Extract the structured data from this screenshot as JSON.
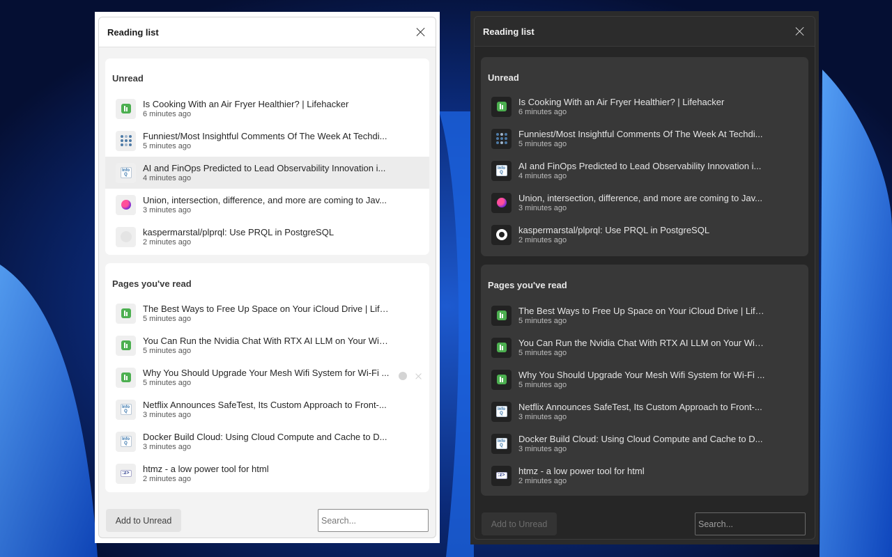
{
  "panels": {
    "light": {
      "title": "Reading list",
      "unread_heading": "Unread",
      "read_heading": "Pages you've read",
      "add_button_label": "Add to Unread",
      "search_placeholder": "Search...",
      "unread": [
        {
          "title": "Is Cooking With an Air Fryer Healthier? | Lifehacker",
          "time": "6 minutes ago",
          "icon": "lifehacker-icon"
        },
        {
          "title": "Funniest/Most Insightful Comments Of The Week At Techdi...",
          "time": "5 minutes ago",
          "icon": "techdirt-icon"
        },
        {
          "title": "AI and FinOps Predicted to Lead Observability Innovation i...",
          "time": "4 minutes ago",
          "icon": "infoq-icon"
        },
        {
          "title": "Union, intersection, difference, and more are coming to Jav...",
          "time": "3 minutes ago",
          "icon": "union-site-icon"
        },
        {
          "title": "kaspermarstal/plprql: Use PRQL in PostgreSQL",
          "time": "2 minutes ago",
          "icon": "github-icon"
        }
      ],
      "read": [
        {
          "title": "The Best Ways to Free Up Space on Your iCloud Drive | Life...",
          "time": "5 minutes ago",
          "icon": "lifehacker-icon"
        },
        {
          "title": "You Can Run the Nvidia Chat With RTX AI LLM on Your Win...",
          "time": "5 minutes ago",
          "icon": "lifehacker-icon"
        },
        {
          "title": "Why You Should Upgrade Your Mesh Wifi System for Wi-Fi ...",
          "time": "5 minutes ago",
          "icon": "lifehacker-icon"
        },
        {
          "title": "Netflix Announces SafeTest, Its Custom Approach to Front-...",
          "time": "3 minutes ago",
          "icon": "infoq-icon"
        },
        {
          "title": "Docker Build Cloud: Using Cloud Compute and Cache to D...",
          "time": "3 minutes ago",
          "icon": "infoq-icon"
        },
        {
          "title": "htmz - a low power tool for html",
          "time": "2 minutes ago",
          "icon": "htmz-icon"
        }
      ]
    },
    "dark": {
      "title": "Reading list",
      "unread_heading": "Unread",
      "read_heading": "Pages you've read",
      "add_button_label": "Add to Unread",
      "search_placeholder": "Search...",
      "unread": [
        {
          "title": "Is Cooking With an Air Fryer Healthier? | Lifehacker",
          "time": "6 minutes ago",
          "icon": "lifehacker-icon"
        },
        {
          "title": "Funniest/Most Insightful Comments Of The Week At Techdi...",
          "time": "5 minutes ago",
          "icon": "techdirt-icon"
        },
        {
          "title": "AI and FinOps Predicted to Lead Observability Innovation i...",
          "time": "4 minutes ago",
          "icon": "infoq-icon"
        },
        {
          "title": "Union, intersection, difference, and more are coming to Jav...",
          "time": "3 minutes ago",
          "icon": "union-site-icon"
        },
        {
          "title": "kaspermarstal/plprql: Use PRQL in PostgreSQL",
          "time": "2 minutes ago",
          "icon": "github-icon"
        }
      ],
      "read": [
        {
          "title": "The Best Ways to Free Up Space on Your iCloud Drive | Life...",
          "time": "5 minutes ago",
          "icon": "lifehacker-icon"
        },
        {
          "title": "You Can Run the Nvidia Chat With RTX AI LLM on Your Win...",
          "time": "5 minutes ago",
          "icon": "lifehacker-icon"
        },
        {
          "title": "Why You Should Upgrade Your Mesh Wifi System for Wi-Fi ...",
          "time": "5 minutes ago",
          "icon": "lifehacker-icon"
        },
        {
          "title": "Netflix Announces SafeTest, Its Custom Approach to Front-...",
          "time": "3 minutes ago",
          "icon": "infoq-icon"
        },
        {
          "title": "Docker Build Cloud: Using Cloud Compute and Cache to D...",
          "time": "3 minutes ago",
          "icon": "infoq-icon"
        },
        {
          "title": "htmz - a low power tool for html",
          "time": "2 minutes ago",
          "icon": "htmz-icon"
        }
      ]
    }
  },
  "colors": {
    "wallpaper_base": "#0a1a4a",
    "wallpaper_accent": "#2f7fe0",
    "lifehacker_green": "#4caf50",
    "infoq_blue": "#2f6fa8"
  }
}
